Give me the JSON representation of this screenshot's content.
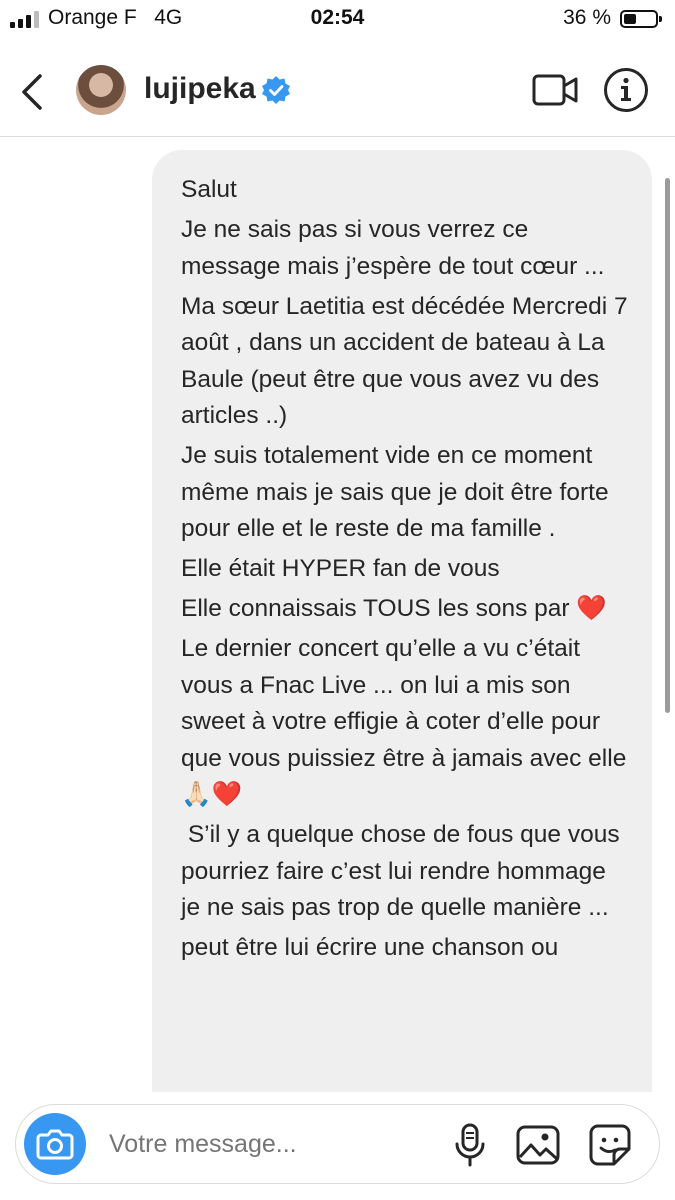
{
  "status_bar": {
    "carrier": "Orange F",
    "network": "4G",
    "time": "02:54",
    "battery": "36 %",
    "battery_level": 0.36
  },
  "header": {
    "username": "lujipeka",
    "verified": true,
    "icons": [
      "back-icon",
      "video-call-icon",
      "info-icon"
    ]
  },
  "message": {
    "paragraphs": [
      "Salut",
      "Je ne sais pas si vous verrez ce message mais j’espère de tout cœur ...",
      "Ma sœur Laetitia est décédée Mercredi 7 août , dans un accident de bateau à La Baule (peut être que vous avez vu des articles ..)",
      "Je suis totalement vide en ce moment même mais je sais que je doit être forte pour elle et le reste de ma famille .",
      "Elle était HYPER fan de vous",
      "Elle connaissais TOUS les sons par ❤️",
      "Le dernier concert qu’elle a vu c’était vous a Fnac Live ... on lui a mis son sweet à votre effigie à coter d’elle pour que vous puissiez être à jamais avec elle 🙏🏻❤️",
      " S’il y a quelque chose de fous que vous pourriez faire c’est lui rendre hommage je ne sais pas trop de quelle manière ...",
      "peut être lui écrire une chanson ou"
    ]
  },
  "composer": {
    "placeholder": "Votre message...",
    "icons": [
      "camera-icon",
      "microphone-icon",
      "gallery-icon",
      "sticker-icon"
    ],
    "camera_color": "#3897f0"
  },
  "colors": {
    "bubble": "#efefef",
    "verified": "#3897f0"
  }
}
